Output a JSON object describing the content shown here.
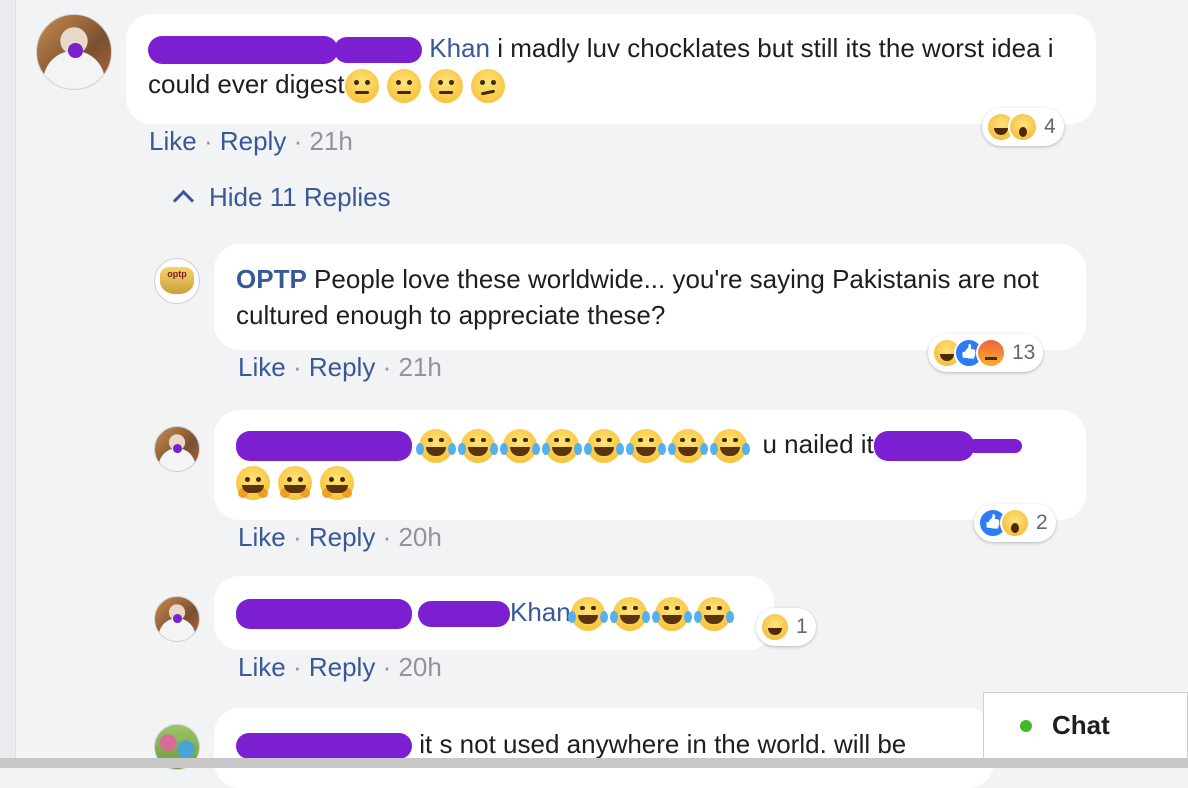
{
  "actions": {
    "like": "Like",
    "reply": "Reply",
    "separator": "·"
  },
  "comments": [
    {
      "name": "Khan",
      "text": "i madly luv chocklates but still its the worst idea i could ever digest",
      "time": "21h",
      "reaction_count": "4",
      "reaction_icons": [
        "haha-icon",
        "wow-icon"
      ]
    },
    {
      "name": "OPTP",
      "text": "People love these worldwide... you're saying Pakistanis are not cultured enough to appreciate these?",
      "time": "21h",
      "reaction_count": "13",
      "reaction_icons": [
        "haha-icon",
        "like-icon",
        "angry-icon"
      ]
    },
    {
      "text": "u nailed it",
      "time": "20h",
      "reaction_count": "2",
      "reaction_icons": [
        "like-icon",
        "wow-icon"
      ]
    },
    {
      "name": "Khan",
      "time": "20h",
      "reaction_count": "1",
      "reaction_icons": [
        "haha-icon"
      ]
    },
    {
      "text": "it s not used anywhere in the world. will be"
    }
  ],
  "hide_replies": "Hide 11 Replies",
  "chat": {
    "label": "Chat",
    "status_color": "#42b72a"
  },
  "colors": {
    "link": "#385898",
    "redaction": "#7b1fd0",
    "bubble": "#ffffff",
    "background": "#f2f3f5"
  }
}
